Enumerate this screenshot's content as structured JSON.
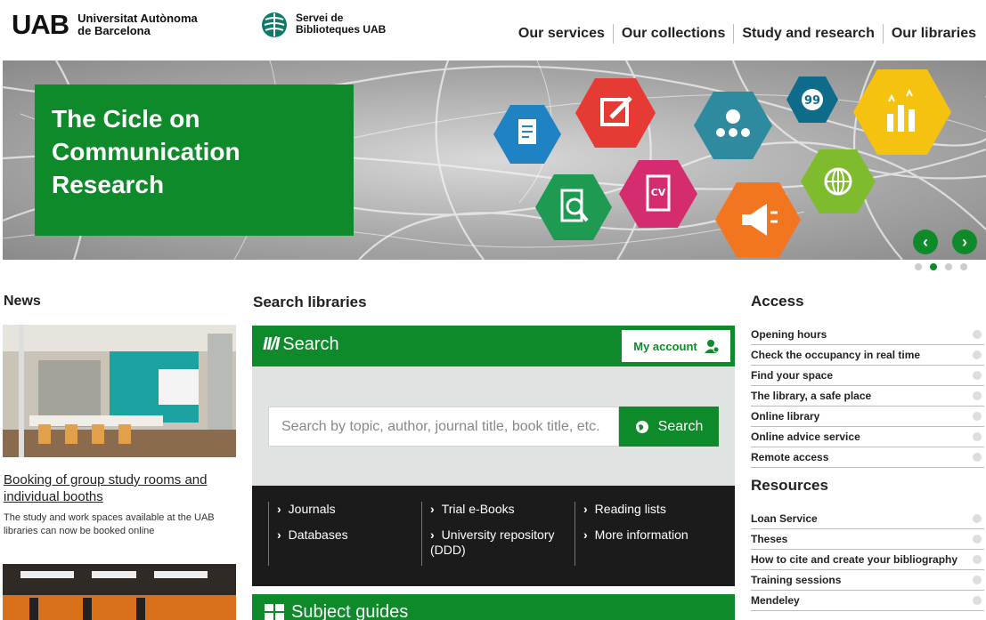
{
  "header": {
    "uab_mark": "UAB",
    "uab_line1": "Universitat Autònoma",
    "uab_line2": "de Barcelona",
    "sb_line1": "Servei de",
    "sb_line2": "Biblioteques UAB",
    "nav": [
      "Our services",
      "Our collections",
      "Study and research",
      "Our libraries"
    ]
  },
  "hero": {
    "title_line1": "The Cicle on",
    "title_line2": "Communication Research",
    "prev_label": "‹",
    "next_label": "›",
    "active_slide": 2,
    "slide_count": 4
  },
  "news": {
    "title": "News",
    "item_title": "Booking of group study rooms and individual booths",
    "item_desc": "The study and work spaces available at the UAB libraries can now be booked online"
  },
  "search": {
    "section_title": "Search libraries",
    "brand": "Search",
    "my_account": "My account",
    "placeholder": "Search by topic, author, journal title, book title, etc.",
    "button": "Search",
    "links": [
      [
        "Journals",
        "Databases"
      ],
      [
        "Trial e-Books",
        "University repository (DDD)"
      ],
      [
        "Reading lists",
        "More information"
      ]
    ],
    "subject_guides": "Subject guides"
  },
  "access": {
    "title": "Access",
    "items": [
      "Opening hours",
      "Check the occupancy in real time",
      "Find your space",
      "The library, a safe place",
      "Online library",
      "Online advice service",
      "Remote access"
    ]
  },
  "resources": {
    "title": "Resources",
    "items": [
      "Loan Service",
      "Theses",
      "How to cite and create your bibliography",
      "Training sessions",
      "Mendeley"
    ]
  },
  "colors": {
    "brand_green": "#0f8a2a",
    "dark_panel": "#1b1b1b",
    "search_bg": "#dfe4e3"
  }
}
